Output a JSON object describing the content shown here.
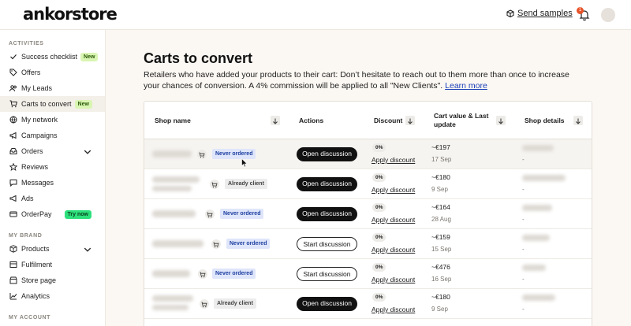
{
  "header": {
    "logo": "ankorstore",
    "send_samples": "Send samples",
    "notification_count": "1"
  },
  "sidebar": {
    "activities_title": "ACTIVITIES",
    "items": [
      {
        "label": "Success checklist",
        "icon": "check-icon",
        "badge": "New"
      },
      {
        "label": "Offers",
        "icon": "tag-icon"
      },
      {
        "label": "My Leads",
        "icon": "users-icon"
      },
      {
        "label": "Carts to convert",
        "icon": "cart-icon",
        "badge": "New",
        "active": true
      },
      {
        "label": "My network",
        "icon": "globe-icon"
      },
      {
        "label": "Campaigns",
        "icon": "megaphone-icon"
      },
      {
        "label": "Orders",
        "icon": "inbox-icon"
      },
      {
        "label": "Reviews",
        "icon": "star-icon"
      },
      {
        "label": "Messages",
        "icon": "chat-icon"
      },
      {
        "label": "Ads",
        "icon": "ads-icon"
      },
      {
        "label": "OrderPay",
        "icon": "payment-icon",
        "badge": "Try now"
      }
    ],
    "brand_title": "MY BRAND",
    "brand_items": [
      {
        "label": "Products",
        "icon": "box-icon"
      },
      {
        "label": "Fulfilment",
        "icon": "truck-icon"
      },
      {
        "label": "Store page",
        "icon": "store-icon"
      },
      {
        "label": "Analytics",
        "icon": "chart-icon"
      }
    ],
    "account_title": "MY ACCOUNT"
  },
  "main": {
    "title": "Carts to convert",
    "description": "Retailers who have added your products to their cart: Don’t hesitate to reach out to them more than once to increase your chances of conversion. A 4% commission will be applied to all \"New Clients\".",
    "learn_more": "Learn more"
  },
  "table": {
    "headers": {
      "shop_name": "Shop name",
      "actions": "Actions",
      "discount": "Discount",
      "cart_value": "Cart value & Last update",
      "shop_details": "Shop details"
    },
    "apply_label": "Apply discount",
    "rows": [
      {
        "status": "Never ordered",
        "status_type": "never",
        "action": "Open discussion",
        "action_type": "dark",
        "discount": "0%",
        "value": "~€197",
        "date": "17 Sep",
        "details": "-"
      },
      {
        "status": "Already client",
        "status_type": "already",
        "action": "Open discussion",
        "action_type": "dark",
        "discount": "0%",
        "value": "~€180",
        "date": "9 Sep",
        "details": "-"
      },
      {
        "status": "Never ordered",
        "status_type": "never",
        "action": "Open discussion",
        "action_type": "dark",
        "discount": "0%",
        "value": "~€164",
        "date": "28 Aug",
        "details": "-"
      },
      {
        "status": "Never ordered",
        "status_type": "never",
        "action": "Start discussion",
        "action_type": "light",
        "discount": "0%",
        "value": "~€159",
        "date": "15 Sep",
        "details": "-"
      },
      {
        "status": "Never ordered",
        "status_type": "never",
        "action": "Start discussion",
        "action_type": "light",
        "discount": "0%",
        "value": "~€476",
        "date": "16 Sep",
        "details": "-"
      },
      {
        "status": "Already client",
        "status_type": "already",
        "action": "Open discussion",
        "action_type": "dark",
        "discount": "0%",
        "value": "~€180",
        "date": "9 Sep",
        "details": "-"
      }
    ]
  }
}
